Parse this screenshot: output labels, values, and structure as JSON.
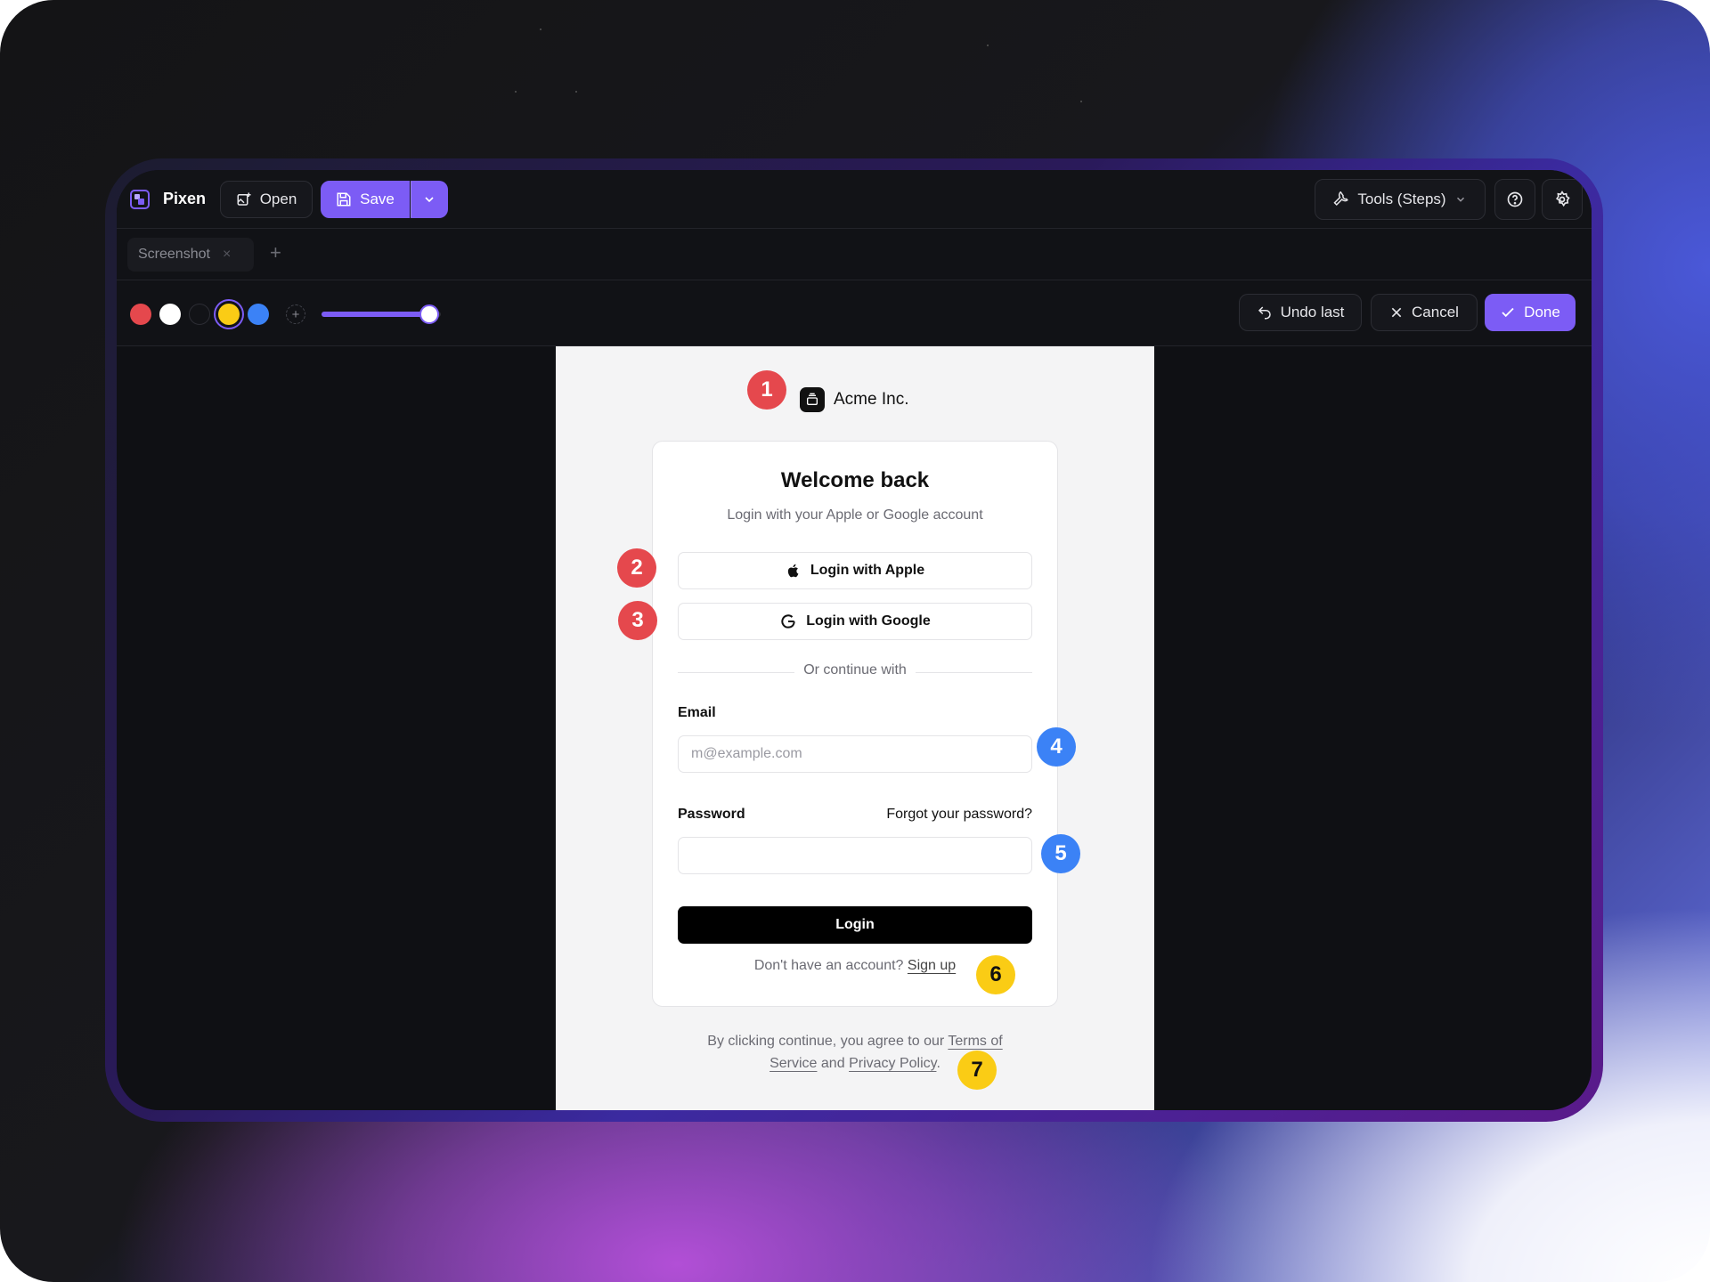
{
  "app": {
    "name": "Pixen",
    "open_label": "Open",
    "save_label": "Save",
    "tools_label": "Tools (Steps)"
  },
  "tabs": [
    {
      "label": "Screenshot",
      "close": "×"
    }
  ],
  "new_tab": "+",
  "toolbar": {
    "colors": [
      "#e5484d",
      "#ffffff",
      "#121317",
      "#facc15",
      "#3b82f6"
    ],
    "selected_color": "#facc15",
    "add_color": "+",
    "brush_size_level": 0.9,
    "undo_label": "Undo last",
    "cancel_label": "Cancel",
    "done_label": "Done"
  },
  "screenshot": {
    "brand": "Acme Inc.",
    "title": "Welcome back",
    "subtitle": "Login with your Apple or Google account",
    "apple_label": "Login with Apple",
    "google_label": "Login with Google",
    "divider_text": "Or continue with",
    "email_label": "Email",
    "email_placeholder": "m@example.com",
    "password_label": "Password",
    "forgot_label": "Forgot your password?",
    "login_label": "Login",
    "signup_prompt": "Don't have an account?",
    "signup_link": "Sign up",
    "terms_prefix": "By clicking continue, you agree to our",
    "terms_link": "Terms of Service",
    "terms_and": "and",
    "privacy_link": "Privacy Policy",
    "terms_suffix": "."
  },
  "markers": [
    "1",
    "2",
    "3",
    "4",
    "5",
    "6",
    "7"
  ]
}
